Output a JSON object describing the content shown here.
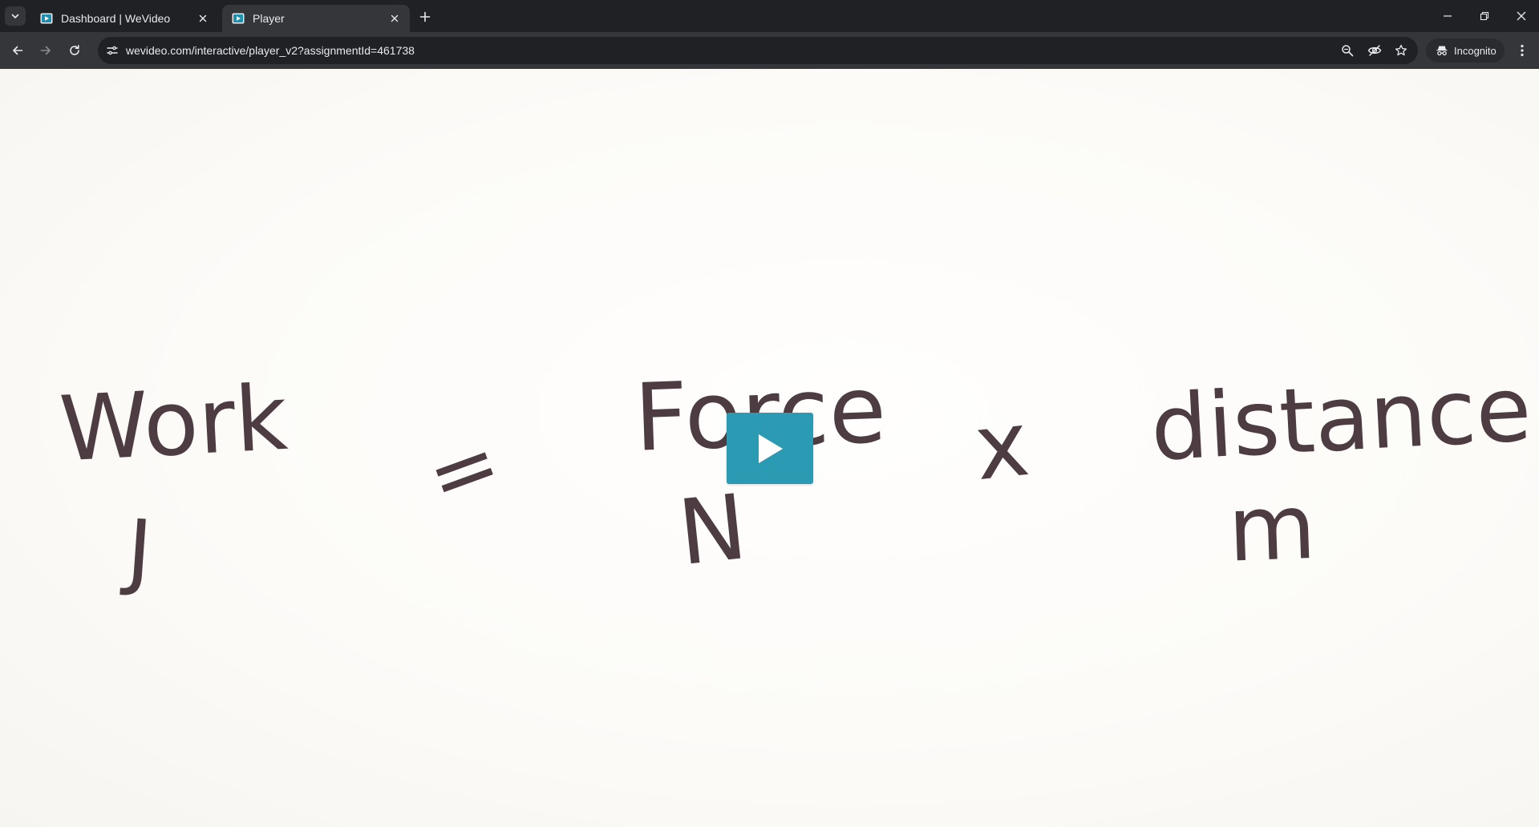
{
  "browser": {
    "tabs": [
      {
        "title": "Dashboard | WeVideo",
        "active": false
      },
      {
        "title": "Player",
        "active": true
      }
    ],
    "url": "wevideo.com/interactive/player_v2?assignmentId=461738",
    "incognito_label": "Incognito"
  },
  "video": {
    "state": "paused",
    "play_button_color": "#2a9bb2",
    "handwriting_color": "#4d3d42",
    "equation": {
      "quantities": [
        "Work",
        "Force",
        "distance"
      ],
      "units": [
        "J",
        "N",
        "m"
      ],
      "equals": "=",
      "times": "x"
    }
  }
}
